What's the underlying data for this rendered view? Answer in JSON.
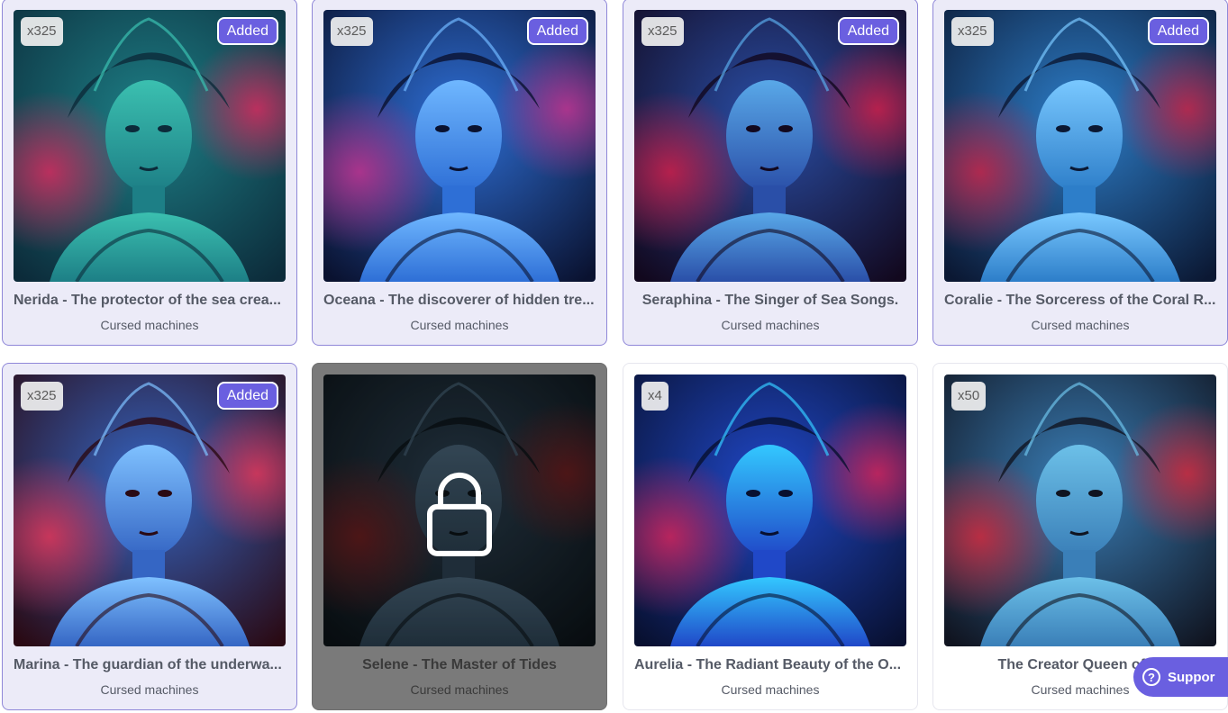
{
  "cards": [
    {
      "title": "Nerida - The protector of the sea crea...",
      "collection": "Cursed machines",
      "count": "x325",
      "badge": "Added",
      "state": "added",
      "palette": [
        "#0c2b3a",
        "#1d7f86",
        "#d62a5e",
        "#3bc0b0"
      ]
    },
    {
      "title": "Oceana - The discoverer of hidden tre...",
      "collection": "Cursed machines",
      "count": "x325",
      "badge": "Added",
      "state": "added",
      "palette": [
        "#0a1230",
        "#2e6fd6",
        "#c2338f",
        "#6fb7ff"
      ]
    },
    {
      "title": "Seraphina - The Singer of Sea Songs.",
      "collection": "Cursed machines",
      "count": "x325",
      "badge": "Added",
      "state": "added",
      "palette": [
        "#12081e",
        "#2a4fa8",
        "#cf1f4a",
        "#59a8e8"
      ]
    },
    {
      "title": "Coralie - The Sorceress of the Coral R...",
      "collection": "Cursed machines",
      "count": "x325",
      "badge": "Added",
      "state": "added",
      "palette": [
        "#0b1833",
        "#2d7ec9",
        "#c72549",
        "#79c8ff"
      ]
    },
    {
      "title": "Marina - The guardian of the underwa...",
      "collection": "Cursed machines",
      "count": "x325",
      "badge": "Added",
      "state": "added",
      "palette": [
        "#2a0a14",
        "#3566c4",
        "#e2375a",
        "#7fc1ff"
      ]
    },
    {
      "title": "Selene - The Master of Tides",
      "collection": "Cursed machines",
      "count": "",
      "badge": "",
      "state": "locked",
      "palette": [
        "#0a1014",
        "#263846",
        "#6a1a1a",
        "#3e5566"
      ]
    },
    {
      "title": "Aurelia - The Radiant Beauty of the O...",
      "collection": "Cursed machines",
      "count": "x4",
      "badge": "",
      "state": "plain",
      "palette": [
        "#081030",
        "#2048c8",
        "#d4245a",
        "#33c8ff"
      ]
    },
    {
      "title": "The Creator Queen of th",
      "collection": "Cursed machines",
      "count": "x50",
      "badge": "",
      "state": "plain",
      "palette": [
        "#101420",
        "#3a7fb8",
        "#d22a3e",
        "#6cc0e8"
      ]
    }
  ],
  "support": {
    "label": "Suppor",
    "icon": "question-circle-icon"
  }
}
